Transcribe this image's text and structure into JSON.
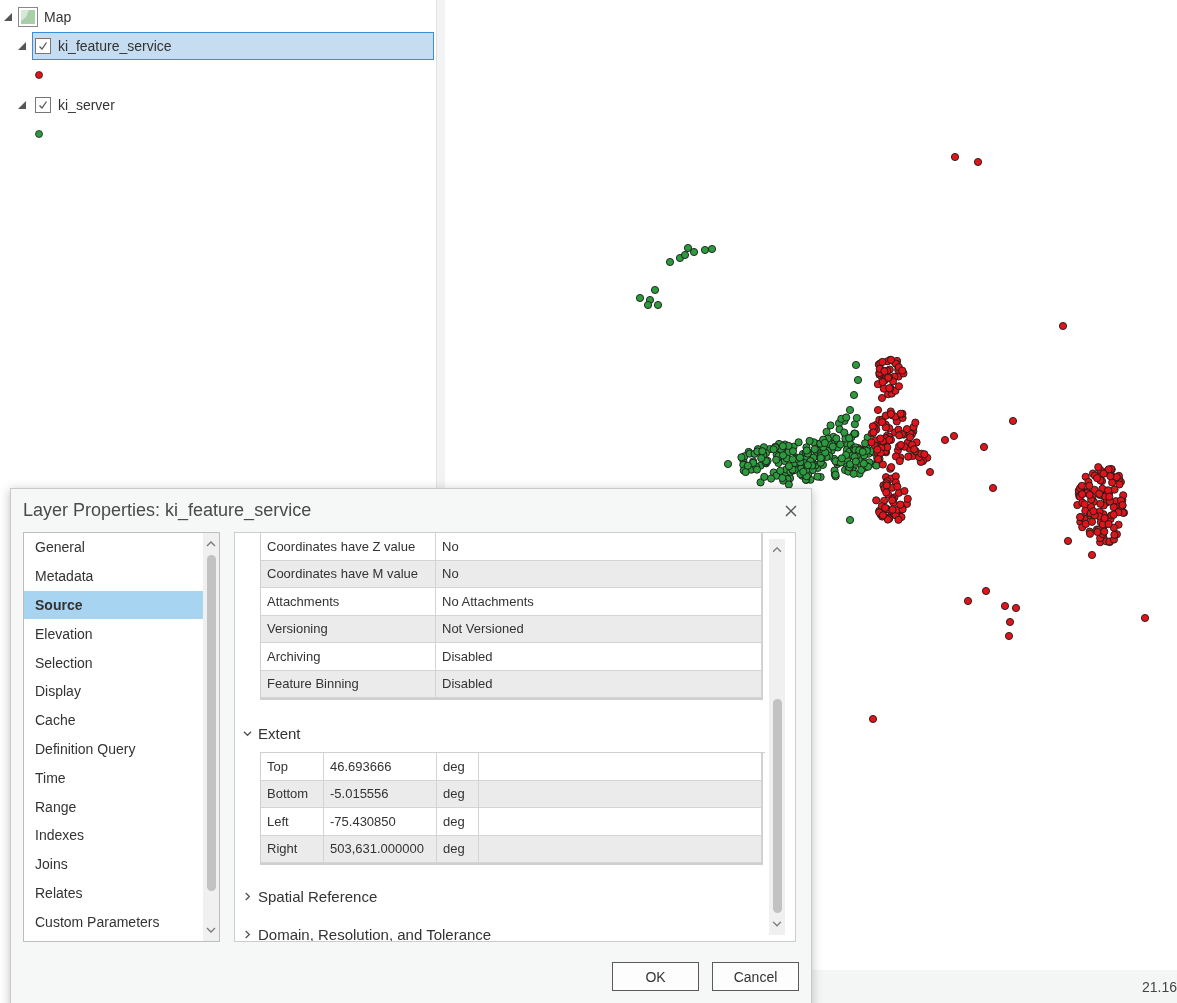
{
  "contents": {
    "map": {
      "label": "Map",
      "expanded": true,
      "layers": [
        {
          "label": "ki_feature_service",
          "checked": true,
          "selected": true,
          "expanded": true,
          "color": "#e0141b"
        },
        {
          "label": "ki_server",
          "checked": true,
          "selected": false,
          "expanded": true,
          "color": "#2e9a3e"
        }
      ]
    }
  },
  "map_view": {
    "status_bar": {
      "scale": "21.16"
    }
  },
  "dialog": {
    "title": "Layer Properties: ki_feature_service",
    "nav": [
      {
        "label": "General",
        "selected": false
      },
      {
        "label": "Metadata",
        "selected": false
      },
      {
        "label": "Source",
        "selected": true
      },
      {
        "label": "Elevation",
        "selected": false
      },
      {
        "label": "Selection",
        "selected": false
      },
      {
        "label": "Display",
        "selected": false
      },
      {
        "label": "Cache",
        "selected": false
      },
      {
        "label": "Definition Query",
        "selected": false
      },
      {
        "label": "Time",
        "selected": false
      },
      {
        "label": "Range",
        "selected": false
      },
      {
        "label": "Indexes",
        "selected": false
      },
      {
        "label": "Joins",
        "selected": false
      },
      {
        "label": "Relates",
        "selected": false
      },
      {
        "label": "Custom Parameters",
        "selected": false
      }
    ],
    "properties": [
      [
        "Coordinates have Z value",
        "No"
      ],
      [
        "Coordinates have M value",
        "No"
      ],
      [
        "Attachments",
        "No Attachments"
      ],
      [
        "Versioning",
        "Not Versioned"
      ],
      [
        "Archiving",
        "Disabled"
      ],
      [
        "Feature Binning",
        "Disabled"
      ]
    ],
    "sections": [
      {
        "title": "Extent",
        "expanded": true,
        "rows": [
          [
            "Top",
            "46.693666",
            "deg"
          ],
          [
            "Bottom",
            "-5.015556",
            "deg"
          ],
          [
            "Left",
            "-75.430850",
            "deg"
          ],
          [
            "Right",
            "503,631.000000",
            "deg"
          ]
        ]
      },
      {
        "title": "Spatial Reference",
        "expanded": false
      },
      {
        "title": "Domain, Resolution, and Tolerance",
        "expanded": false
      }
    ],
    "buttons": [
      "OK",
      "Cancel"
    ]
  }
}
